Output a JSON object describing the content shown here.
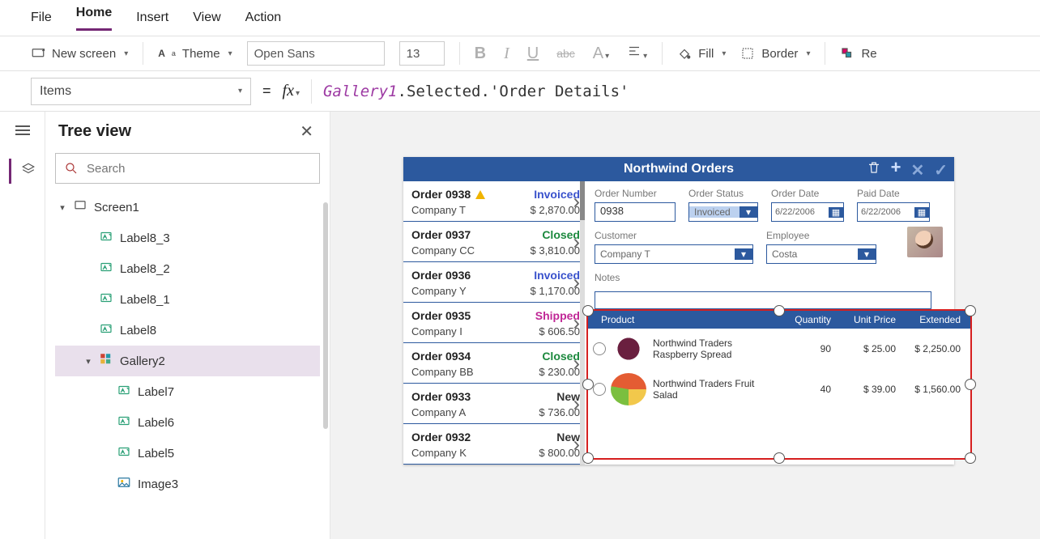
{
  "menu": {
    "file": "File",
    "home": "Home",
    "insert": "Insert",
    "view": "View",
    "action": "Action"
  },
  "ribbon": {
    "newscreen": "New screen",
    "theme": "Theme",
    "font": "Open Sans",
    "fontsize": "13",
    "fill": "Fill",
    "border": "Border",
    "reorder": "Re"
  },
  "formula": {
    "property": "Items",
    "expr_ident": "Gallery1",
    "expr_rest": ".Selected.'Order Details'"
  },
  "treeview": {
    "title": "Tree view",
    "search_placeholder": "Search",
    "items": [
      {
        "label": "Screen1",
        "icon": "screen",
        "indent": 0,
        "expander": "▾"
      },
      {
        "label": "Label8_3",
        "icon": "label",
        "indent": 1
      },
      {
        "label": "Label8_2",
        "icon": "label",
        "indent": 1
      },
      {
        "label": "Label8_1",
        "icon": "label",
        "indent": 1
      },
      {
        "label": "Label8",
        "icon": "label",
        "indent": 1
      },
      {
        "label": "Gallery2",
        "icon": "gallery",
        "indent": 1,
        "expander": "▾",
        "selected": true
      },
      {
        "label": "Label7",
        "icon": "label",
        "indent": 2
      },
      {
        "label": "Label6",
        "icon": "label",
        "indent": 2
      },
      {
        "label": "Label5",
        "icon": "label",
        "indent": 2
      },
      {
        "label": "Image3",
        "icon": "image",
        "indent": 2
      }
    ]
  },
  "app": {
    "title": "Northwind Orders",
    "orders": [
      {
        "code": "Order 0938",
        "company": "Company T",
        "status": "Invoiced",
        "amount": "$ 2,870.00",
        "warn": true
      },
      {
        "code": "Order 0937",
        "company": "Company CC",
        "status": "Closed",
        "amount": "$ 3,810.00"
      },
      {
        "code": "Order 0936",
        "company": "Company Y",
        "status": "Invoiced",
        "amount": "$ 1,170.00"
      },
      {
        "code": "Order 0935",
        "company": "Company I",
        "status": "Shipped",
        "amount": "$ 606.50"
      },
      {
        "code": "Order 0934",
        "company": "Company BB",
        "status": "Closed",
        "amount": "$ 230.00"
      },
      {
        "code": "Order 0933",
        "company": "Company A",
        "status": "New",
        "amount": "$ 736.00"
      },
      {
        "code": "Order 0932",
        "company": "Company K",
        "status": "New",
        "amount": "$ 800.00"
      }
    ],
    "detail": {
      "labels": {
        "ordnum": "Order Number",
        "ordstatus": "Order Status",
        "orddate": "Order Date",
        "paid": "Paid Date",
        "customer": "Customer",
        "employee": "Employee",
        "notes": "Notes"
      },
      "ordnum": "0938",
      "ordstatus": "Invoiced",
      "orddate": "6/22/2006",
      "paiddate": "6/22/2006",
      "customer": "Company T",
      "employee": "Costa"
    },
    "grid": {
      "headers": {
        "product": "Product",
        "qty": "Quantity",
        "price": "Unit Price",
        "ext": "Extended"
      },
      "rows": [
        {
          "name": "Northwind Traders Raspberry Spread",
          "qty": "90",
          "price": "$ 25.00",
          "ext": "$ 2,250.00",
          "thumb": "berry"
        },
        {
          "name": "Northwind Traders Fruit Salad",
          "qty": "40",
          "price": "$ 39.00",
          "ext": "$ 1,560.00",
          "thumb": "fruit"
        }
      ]
    }
  }
}
